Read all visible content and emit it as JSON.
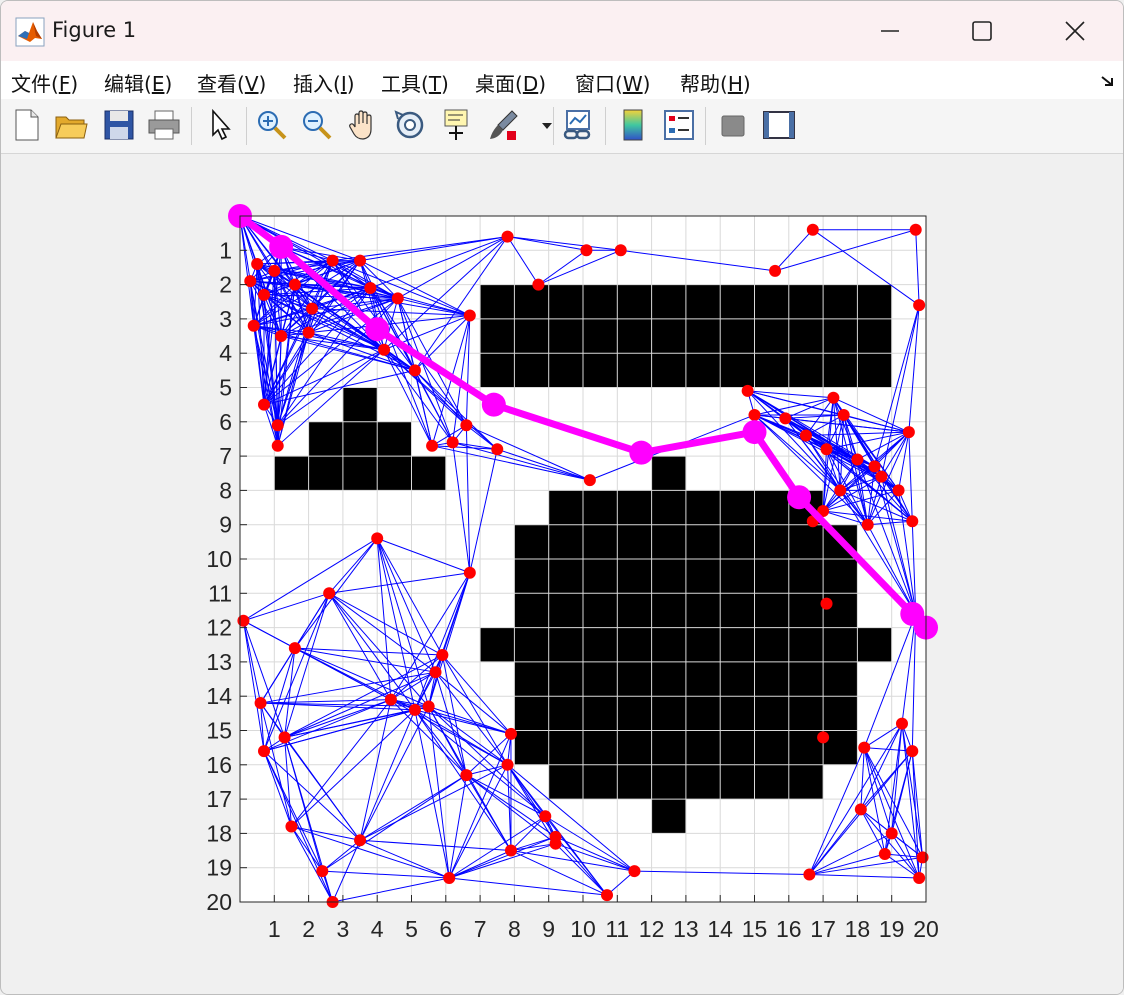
{
  "window": {
    "title": "Figure 1"
  },
  "menus": [
    {
      "prefix": "文件(",
      "key": "F",
      "suffix": ")"
    },
    {
      "prefix": "编辑(",
      "key": "E",
      "suffix": ")"
    },
    {
      "prefix": "查看(",
      "key": "V",
      "suffix": ")"
    },
    {
      "prefix": "插入(",
      "key": "I",
      "suffix": ")"
    },
    {
      "prefix": "工具(",
      "key": "T",
      "suffix": ")"
    },
    {
      "prefix": "桌面(",
      "key": "D",
      "suffix": ")"
    },
    {
      "prefix": "窗口(",
      "key": "W",
      "suffix": ")"
    },
    {
      "prefix": "帮助(",
      "key": "H",
      "suffix": ")"
    }
  ],
  "toolbar": {
    "icons": [
      "new-figure-icon",
      "open-file-icon",
      "save-icon",
      "print-icon",
      "pointer-icon",
      "zoom-in-icon",
      "zoom-out-icon",
      "pan-hand-icon",
      "rotate-3d-icon",
      "data-cursor-icon",
      "brush-icon",
      "link-plot-icon",
      "colorbar-icon",
      "legend-icon",
      "hide-plot-tools-icon",
      "show-plot-tools-icon"
    ]
  },
  "colors": {
    "edge": "#0000ff",
    "node": "#ff0000",
    "path": "#ff00ff",
    "obstacle": "#000000",
    "grid": "#d9d9d9"
  },
  "chart_data": {
    "type": "scatter",
    "description_free": true,
    "xlim": [
      0,
      20
    ],
    "ylim": [
      0,
      20
    ],
    "y_direction": "reversed",
    "grid": true,
    "xticks": [
      1,
      2,
      3,
      4,
      5,
      6,
      7,
      8,
      9,
      10,
      11,
      12,
      13,
      14,
      15,
      16,
      17,
      18,
      19,
      20
    ],
    "yticks": [
      1,
      2,
      3,
      4,
      5,
      6,
      7,
      8,
      9,
      10,
      11,
      12,
      13,
      14,
      15,
      16,
      17,
      18,
      19,
      20
    ],
    "obstacles": [
      [
        3,
        4,
        5,
        8
      ],
      [
        2,
        3,
        6,
        8
      ],
      [
        1,
        2,
        7,
        8
      ],
      [
        4,
        5,
        6,
        8
      ],
      [
        5,
        6,
        7,
        8
      ],
      [
        7,
        19,
        2,
        5
      ],
      [
        9,
        17,
        8,
        17
      ],
      [
        8,
        9,
        9,
        16
      ],
      [
        17,
        18,
        9,
        16
      ],
      [
        7,
        8,
        12,
        13
      ],
      [
        18,
        19,
        12,
        13
      ],
      [
        12,
        13,
        7,
        8
      ],
      [
        12,
        13,
        17,
        18
      ]
    ],
    "nodes": [
      [
        0,
        0
      ],
      [
        1.2,
        0.9
      ],
      [
        0.5,
        1.4
      ],
      [
        0.3,
        1.9
      ],
      [
        1.0,
        1.6
      ],
      [
        0.7,
        2.3
      ],
      [
        1.6,
        2.0
      ],
      [
        2.7,
        1.3
      ],
      [
        3.5,
        1.3
      ],
      [
        3.8,
        2.1
      ],
      [
        4.6,
        2.4
      ],
      [
        2.1,
        2.7
      ],
      [
        0.4,
        3.2
      ],
      [
        1.2,
        3.5
      ],
      [
        2.0,
        3.4
      ],
      [
        6.7,
        2.9
      ],
      [
        7.8,
        0.6
      ],
      [
        8.7,
        2.0
      ],
      [
        10.1,
        1.0
      ],
      [
        11.1,
        1.0
      ],
      [
        0.7,
        5.5
      ],
      [
        1.1,
        6.1
      ],
      [
        1.1,
        6.7
      ],
      [
        4.2,
        3.9
      ],
      [
        5.1,
        4.5
      ],
      [
        5.6,
        6.7
      ],
      [
        6.2,
        6.6
      ],
      [
        6.6,
        6.1
      ],
      [
        7.5,
        6.8
      ],
      [
        10.2,
        7.7
      ],
      [
        4.0,
        9.4
      ],
      [
        6.7,
        10.4
      ],
      [
        16.7,
        0.4
      ],
      [
        19.7,
        0.4
      ],
      [
        15.6,
        1.6
      ],
      [
        19.8,
        2.6
      ],
      [
        14.8,
        5.1
      ],
      [
        15.0,
        5.8
      ],
      [
        15.9,
        5.9
      ],
      [
        16.5,
        6.4
      ],
      [
        17.3,
        5.3
      ],
      [
        17.6,
        5.8
      ],
      [
        17.1,
        6.8
      ],
      [
        18.0,
        7.1
      ],
      [
        18.5,
        7.3
      ],
      [
        18.7,
        7.6
      ],
      [
        19.2,
        8.0
      ],
      [
        19.5,
        6.3
      ],
      [
        19.6,
        8.9
      ],
      [
        17.5,
        8.0
      ],
      [
        18.3,
        9.0
      ],
      [
        16.7,
        8.9
      ],
      [
        17.0,
        8.6
      ],
      [
        17.1,
        11.3
      ],
      [
        19.7,
        11.6
      ],
      [
        0.1,
        11.8
      ],
      [
        2.6,
        11.0
      ],
      [
        1.6,
        12.6
      ],
      [
        5.9,
        12.8
      ],
      [
        5.7,
        13.3
      ],
      [
        0.6,
        14.2
      ],
      [
        4.4,
        14.1
      ],
      [
        5.1,
        14.4
      ],
      [
        5.5,
        14.3
      ],
      [
        0.7,
        15.6
      ],
      [
        1.3,
        15.2
      ],
      [
        7.9,
        15.1
      ],
      [
        6.6,
        16.3
      ],
      [
        7.8,
        16.0
      ],
      [
        1.5,
        17.8
      ],
      [
        3.5,
        18.2
      ],
      [
        8.9,
        17.5
      ],
      [
        9.2,
        18.1
      ],
      [
        9.2,
        18.3
      ],
      [
        7.9,
        18.5
      ],
      [
        2.4,
        19.1
      ],
      [
        2.7,
        20.0
      ],
      [
        6.1,
        19.3
      ],
      [
        10.7,
        19.8
      ],
      [
        11.5,
        19.1
      ],
      [
        17.0,
        15.2
      ],
      [
        18.2,
        15.5
      ],
      [
        19.3,
        14.8
      ],
      [
        19.6,
        15.6
      ],
      [
        18.1,
        17.3
      ],
      [
        19.0,
        18.0
      ],
      [
        18.8,
        18.6
      ],
      [
        19.9,
        18.7
      ],
      [
        19.8,
        19.3
      ],
      [
        16.6,
        19.2
      ]
    ],
    "path": [
      [
        0,
        0
      ],
      [
        1.2,
        0.9
      ],
      [
        4.0,
        3.3
      ],
      [
        7.4,
        5.5
      ],
      [
        11.7,
        6.9
      ],
      [
        15.0,
        6.3
      ],
      [
        16.3,
        8.2
      ],
      [
        19.6,
        11.6
      ],
      [
        20,
        12
      ]
    ]
  }
}
